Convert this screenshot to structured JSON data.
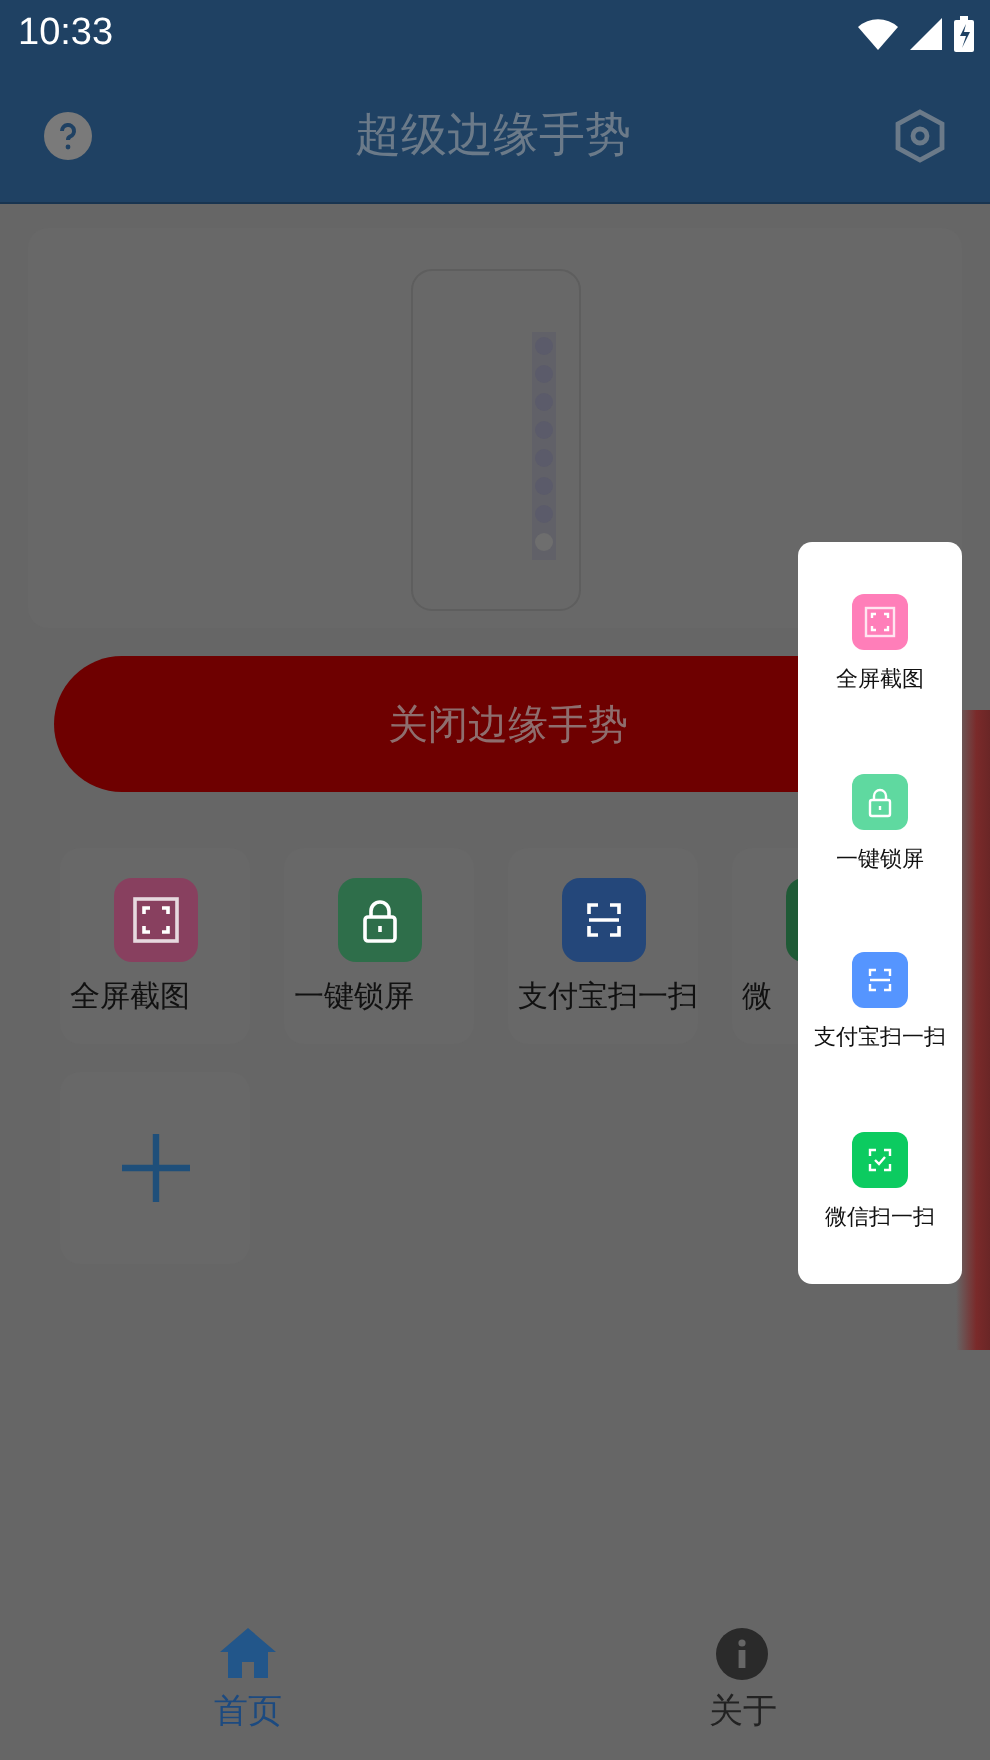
{
  "status_bar": {
    "time": "10:33"
  },
  "app_bar": {
    "title": "超级边缘手势"
  },
  "toggle_button": {
    "label": "关闭边缘手势"
  },
  "shortcuts": [
    {
      "label": "全屏截图",
      "kind": "screenshot",
      "color": "#88405f"
    },
    {
      "label": "一键锁屏",
      "kind": "lock",
      "color": "#2e6e4a"
    },
    {
      "label": "支付宝扫一扫",
      "kind": "scan",
      "color": "#24477a"
    },
    {
      "label": "微",
      "color": "#1f5a36"
    }
  ],
  "popup": {
    "items": [
      {
        "label": "全屏截图",
        "kind": "screenshot",
        "color": "#ff7eb9"
      },
      {
        "label": "一键锁屏",
        "kind": "lock",
        "color": "#5fd9a0"
      },
      {
        "label": "支付宝扫一扫",
        "kind": "scan",
        "color": "#5595ff"
      },
      {
        "label": "微信扫一扫",
        "kind": "scan-check",
        "color": "#0ccb60"
      }
    ]
  },
  "nav": [
    {
      "label": "首页",
      "kind": "home",
      "selected": true
    },
    {
      "label": "关于",
      "kind": "info",
      "selected": false
    }
  ]
}
